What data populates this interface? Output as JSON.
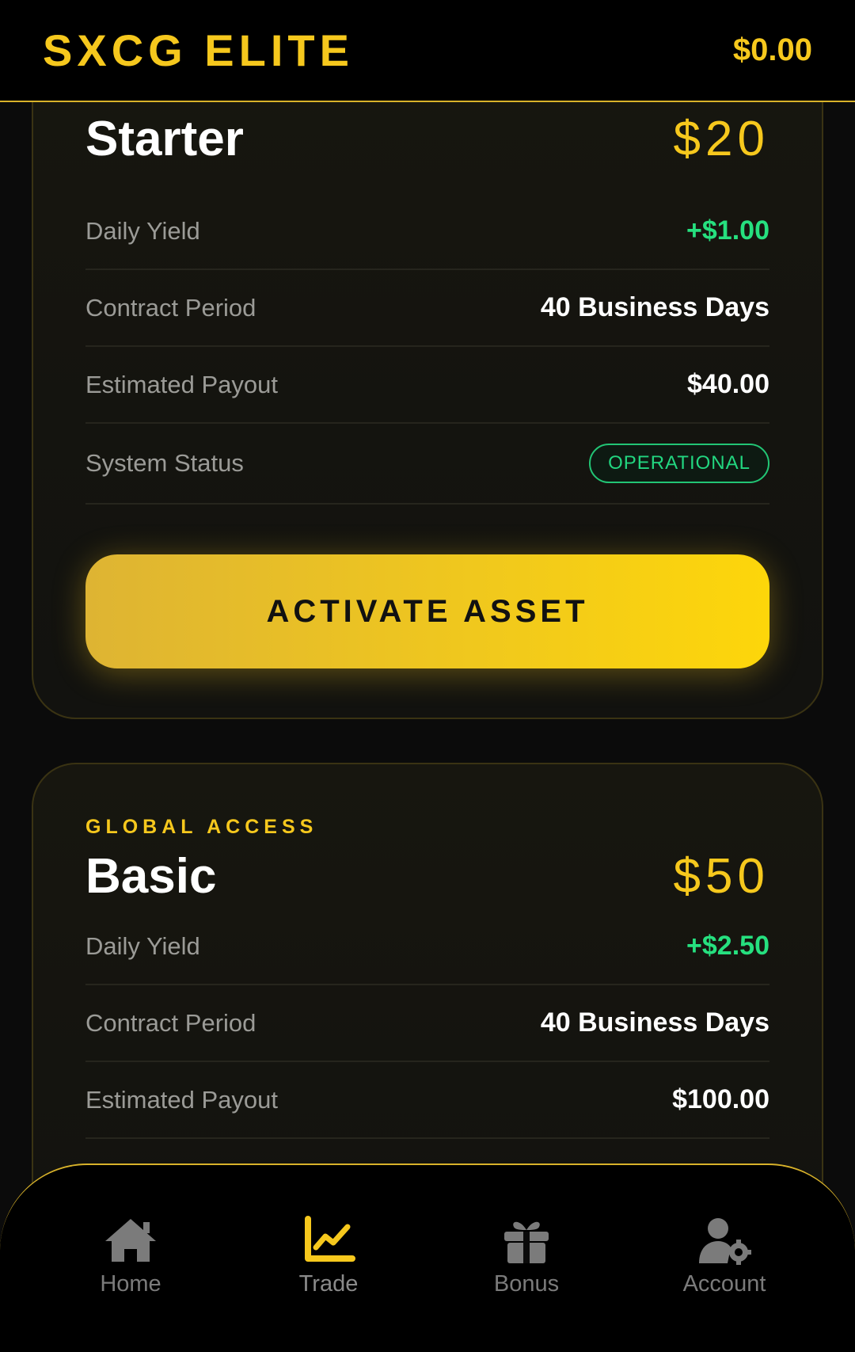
{
  "header": {
    "brand": "SXCG ELITE",
    "balance": "$0.00"
  },
  "plans": [
    {
      "eyebrow": "",
      "name": "Starter",
      "price": "$20",
      "specs": [
        {
          "label": "Daily Yield",
          "value": "+$1.00"
        },
        {
          "label": "Contract Period",
          "value": "40 Business Days"
        },
        {
          "label": "Estimated Payout",
          "value": "$40.00"
        },
        {
          "label": "System Status",
          "value": "OPERATIONAL"
        }
      ],
      "cta": "ACTIVATE ASSET"
    },
    {
      "eyebrow": "GLOBAL ACCESS",
      "name": "Basic",
      "price": "$50",
      "specs": [
        {
          "label": "Daily Yield",
          "value": "+$2.50"
        },
        {
          "label": "Contract Period",
          "value": "40 Business Days"
        },
        {
          "label": "Estimated Payout",
          "value": "$100.00"
        }
      ]
    }
  ],
  "nav": {
    "items": [
      {
        "label": "Home",
        "icon": "home-icon"
      },
      {
        "label": "Trade",
        "icon": "chart-line-icon"
      },
      {
        "label": "Bonus",
        "icon": "gift-icon"
      },
      {
        "label": "Account",
        "icon": "user-gear-icon"
      }
    ],
    "active": "Trade"
  },
  "colors": {
    "accent": "#f6c81d",
    "positive": "#26e07f",
    "muted": "#9b9b97"
  }
}
